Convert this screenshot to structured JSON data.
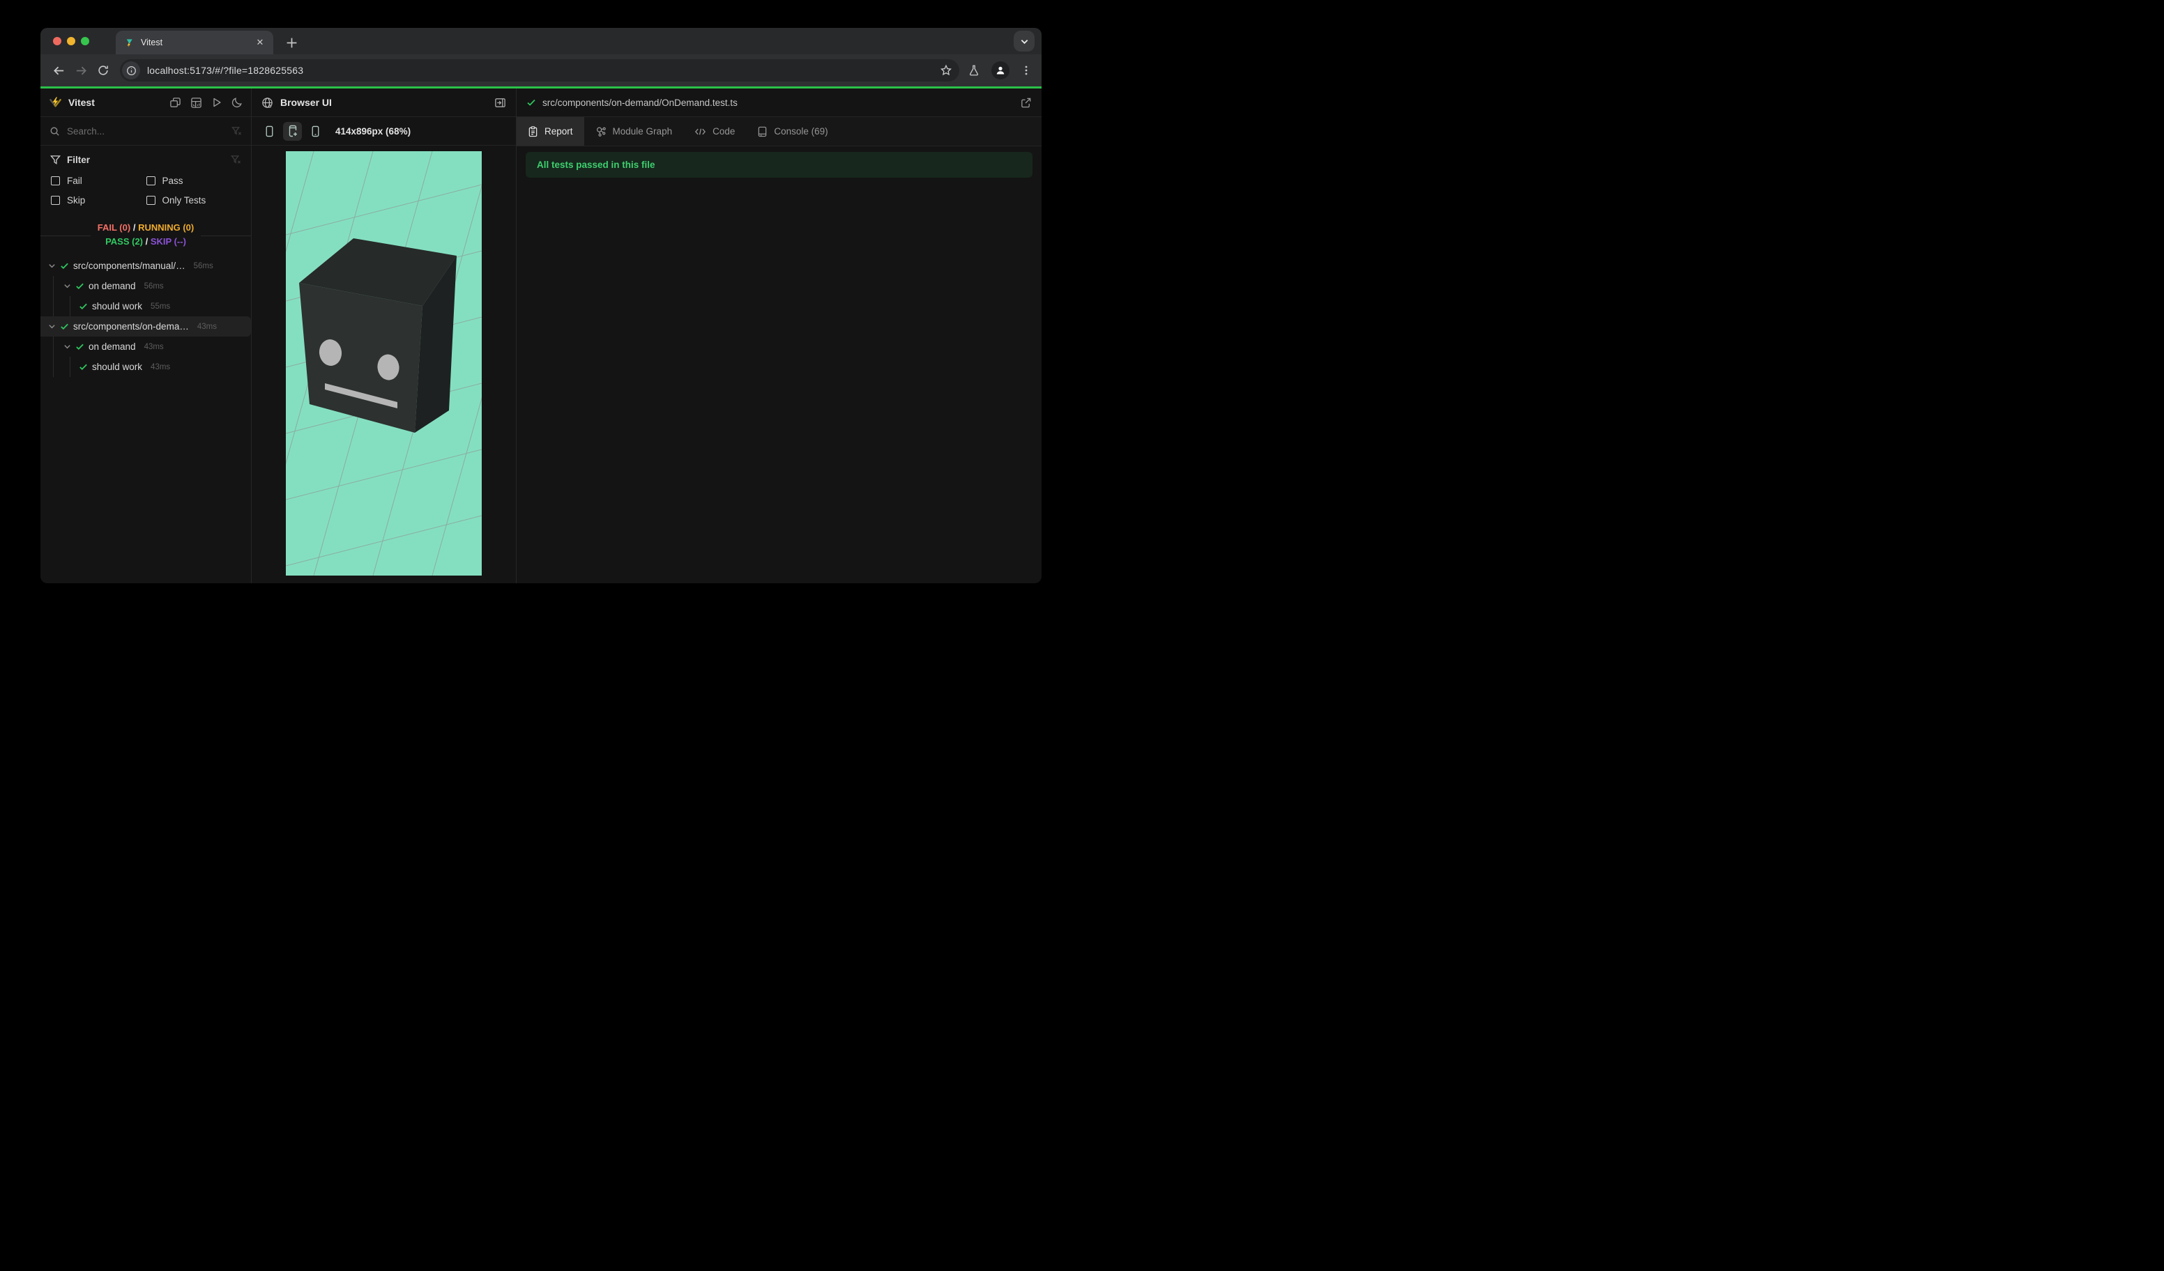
{
  "browser": {
    "tab_title": "Vitest",
    "close_glyph": "✕",
    "url": "localhost:5173/#/?file=1828625563"
  },
  "sidebar": {
    "app_name": "Vitest",
    "search_placeholder": "Search...",
    "filter": {
      "title": "Filter",
      "options": {
        "0": "Fail",
        "1": "Pass",
        "2": "Skip",
        "3": "Only Tests"
      }
    },
    "summary": {
      "fail": "FAIL (0)",
      "running": "RUNNING (0)",
      "pass": "PASS (2)",
      "skip": "SKIP (--)",
      "sep": "/"
    },
    "tree": {
      "0": {
        "label": "src/components/manual/…",
        "duration": "56ms"
      },
      "1": {
        "label": "on demand",
        "duration": "56ms"
      },
      "2": {
        "label": "should work",
        "duration": "55ms"
      },
      "3": {
        "label": "src/components/on-dema…",
        "duration": "43ms"
      },
      "4": {
        "label": "on demand",
        "duration": "43ms"
      },
      "5": {
        "label": "should work",
        "duration": "43ms"
      }
    }
  },
  "browser_panel": {
    "title": "Browser UI",
    "viewport_label": "414x896px (68%)"
  },
  "report_panel": {
    "file_path": "src/components/on-demand/OnDemand.test.ts",
    "tabs": {
      "0": {
        "label": "Report"
      },
      "1": {
        "label": "Module Graph"
      },
      "2": {
        "label": "Code"
      },
      "3": {
        "label": "Console (69)"
      }
    },
    "banner": "All tests passed in this file"
  },
  "colors": {
    "progress_green": "#2bc148",
    "pass_green": "#2fc45f",
    "fail_red": "#f47067",
    "running_amber": "#efac2d",
    "skip_purple": "#8b52d6",
    "banner_bg": "#17271d",
    "banner_text": "#3ecf6e",
    "scene_mint": "#84dfc1",
    "vitest_yellow": "#fcc72b"
  }
}
